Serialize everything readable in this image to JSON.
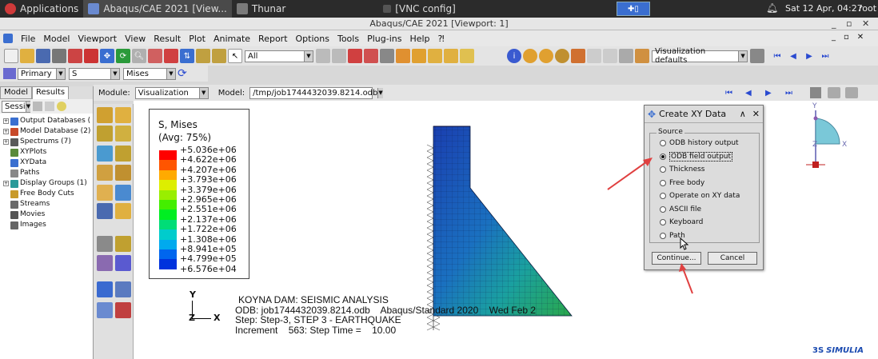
{
  "os_bar": {
    "applications": "Applications",
    "task_abaqus": "Abaqus/CAE 2021 [View...",
    "task_thunar": "Thunar",
    "task_vnc": "[VNC config]",
    "clock": "Sat 12 Apr, 04:27",
    "user": "root"
  },
  "window": {
    "title": "Abaqus/CAE 2021 [Viewport: 1]"
  },
  "menu": [
    "File",
    "Model",
    "Viewport",
    "View",
    "Result",
    "Plot",
    "Animate",
    "Report",
    "Options",
    "Tools",
    "Plug-ins",
    "Help",
    "⁈"
  ],
  "toolbar": {
    "selection_filter": "All",
    "visualization_defaults": "Visualization defaults"
  },
  "field_output_bar": {
    "primary": "Primary",
    "variable": "S",
    "invariant": "Mises"
  },
  "context_bar": {
    "module_label": "Module:",
    "module_value": "Visualization",
    "model_label": "Model:",
    "model_value": "/tmp/job1744432039.8214.odb"
  },
  "tree": {
    "tab_model": "Model",
    "tab_results": "Results",
    "session_combo": "Sessi",
    "items": [
      {
        "label": "Output Databases (",
        "color": "#3a6fd0"
      },
      {
        "label": "Model Database (2)",
        "color": "#c84a2a"
      },
      {
        "label": "Spectrums (7)",
        "color": "#5a5a5a"
      },
      {
        "label": "XYPlots",
        "color": "#5a8a3a"
      },
      {
        "label": "XYData",
        "color": "#3a6fd0"
      },
      {
        "label": "Paths",
        "color": "#888"
      },
      {
        "label": "Display Groups (1)",
        "color": "#2a9a9a"
      },
      {
        "label": "Free Body Cuts",
        "color": "#c89a2a"
      },
      {
        "label": "Streams",
        "color": "#6a6a6a"
      },
      {
        "label": "Movies",
        "color": "#555"
      },
      {
        "label": "Images",
        "color": "#666"
      }
    ]
  },
  "legend": {
    "title_line1": "S, Mises",
    "title_line2": "(Avg: 75%)",
    "values": [
      "+5.036e+06",
      "+4.622e+06",
      "+4.207e+06",
      "+3.793e+06",
      "+3.379e+06",
      "+2.965e+06",
      "+2.551e+06",
      "+2.137e+06",
      "+1.722e+06",
      "+1.308e+06",
      "+8.941e+05",
      "+4.799e+05",
      "+6.576e+04"
    ],
    "colors": [
      "#ff0000",
      "#ff5500",
      "#ffaa00",
      "#ddee00",
      "#99ee00",
      "#44ee00",
      "#00ee22",
      "#00dd77",
      "#00cccc",
      "#00aaee",
      "#0066ee",
      "#0033dd",
      "#0000cc"
    ]
  },
  "viewport_text": {
    "line1": "KOYNA DAM: SEISMIC ANALYSIS",
    "line2": "ODB: job1744432039.8214.odb    Abaqus/Standard 2020    Wed Feb 2",
    "line3": "Step: Step-3, STEP 3 - EARTHQUAKE",
    "line4": "Increment    563: Step Time =    10.00",
    "triad_y": "Y",
    "triad_z": "Z",
    "triad_x": "X",
    "view_y": "Y",
    "view_z": "Z",
    "view_x": "X",
    "brand": "SIMULIA"
  },
  "dialog": {
    "title": "Create XY Data",
    "source_label": "Source",
    "options": [
      {
        "label": "ODB history output",
        "selected": false
      },
      {
        "label": "ODB field output",
        "selected": true
      },
      {
        "label": "Thickness",
        "selected": false
      },
      {
        "label": "Free body",
        "selected": false
      },
      {
        "label": "Operate on XY data",
        "selected": false
      },
      {
        "label": "ASCII file",
        "selected": false
      },
      {
        "label": "Keyboard",
        "selected": false
      },
      {
        "label": "Path",
        "selected": false
      }
    ],
    "continue_label": "Continue...",
    "cancel_label": "Cancel"
  },
  "colors": {
    "annotation_arrow": "#e04040",
    "dam_blue": "#1a3fb0",
    "dam_green": "#2aa84a"
  }
}
